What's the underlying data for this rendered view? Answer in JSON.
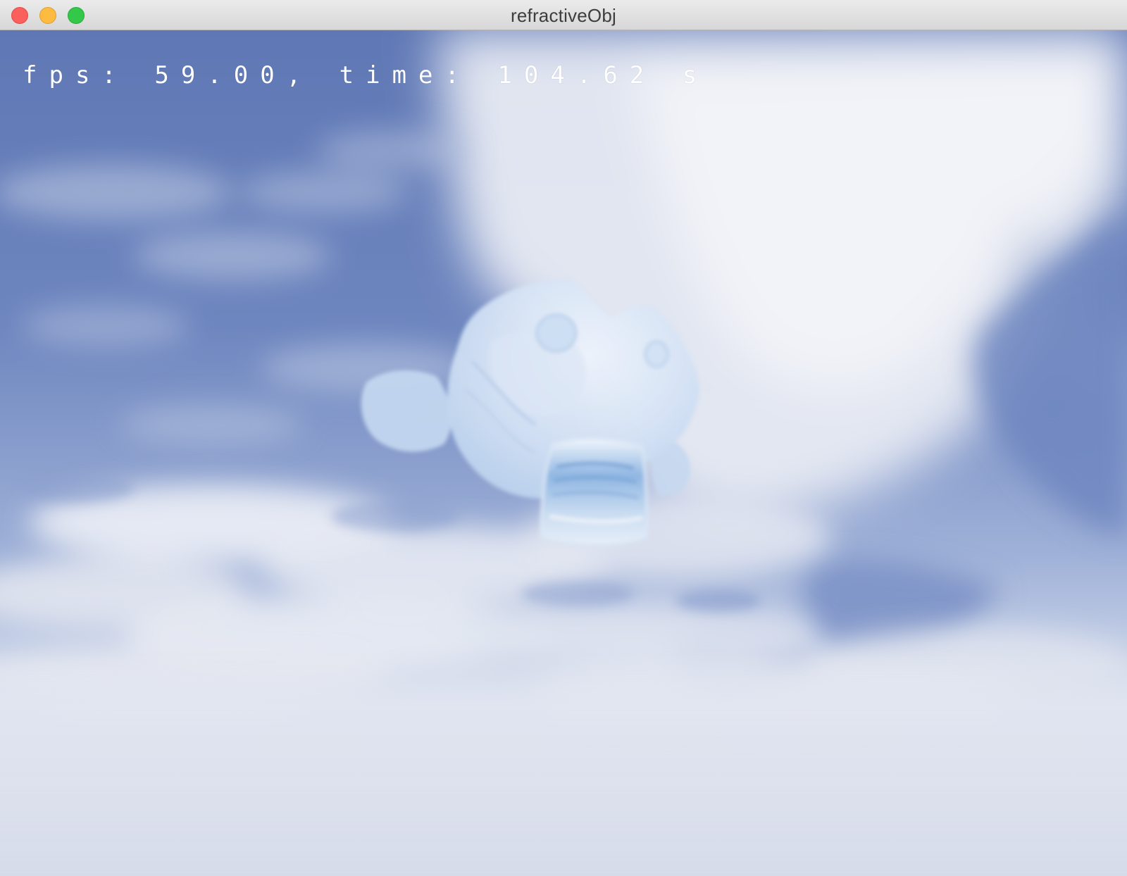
{
  "window": {
    "title": "refractiveObj",
    "controls": {
      "close_color": "#fc605c",
      "minimize_color": "#fdbc40",
      "maximize_color": "#34c84a"
    }
  },
  "overlay": {
    "fps_text": "fps: 59.00, time: 104.62 s"
  },
  "scene": {
    "sky_top_color": "#6079b4",
    "sky_horizon_color": "#dde2ee",
    "object": "refractive-monkey-head"
  }
}
